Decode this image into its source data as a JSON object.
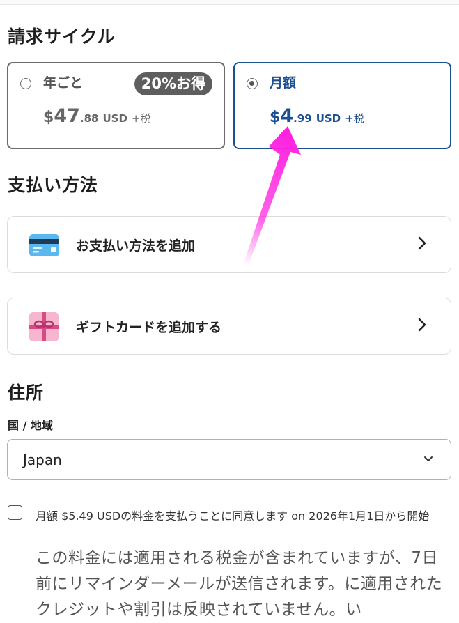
{
  "billing": {
    "title": "請求サイクル",
    "yearly": {
      "name": "年ごと",
      "badge": "20%お得",
      "currency": "$",
      "amount": "47",
      "cents": ".88",
      "code": "USD",
      "tax": "+税",
      "selected": false
    },
    "monthly": {
      "name": "月額",
      "currency": "$",
      "amount": "4",
      "cents": ".99",
      "code": "USD",
      "tax": "+税",
      "selected": true
    }
  },
  "payment": {
    "title": "支払い方法",
    "add_payment": "お支払い方法を追加",
    "add_gift": "ギフトカードを追加する"
  },
  "address": {
    "title": "住所",
    "country_label": "国 / 地域",
    "country_value": "Japan"
  },
  "agreement": {
    "text": "月額 $5.49 USDの料金を支払うことに同意します on 2026年1月1日から開始",
    "checked": false,
    "note": "この料金には適用される税金が含まれていますが、7日前にリマインダーメールが送信されます。に適用されたクレジットや割引は反映されていません。い"
  },
  "annotation": {
    "arrow_color": "#ff1fe0"
  }
}
